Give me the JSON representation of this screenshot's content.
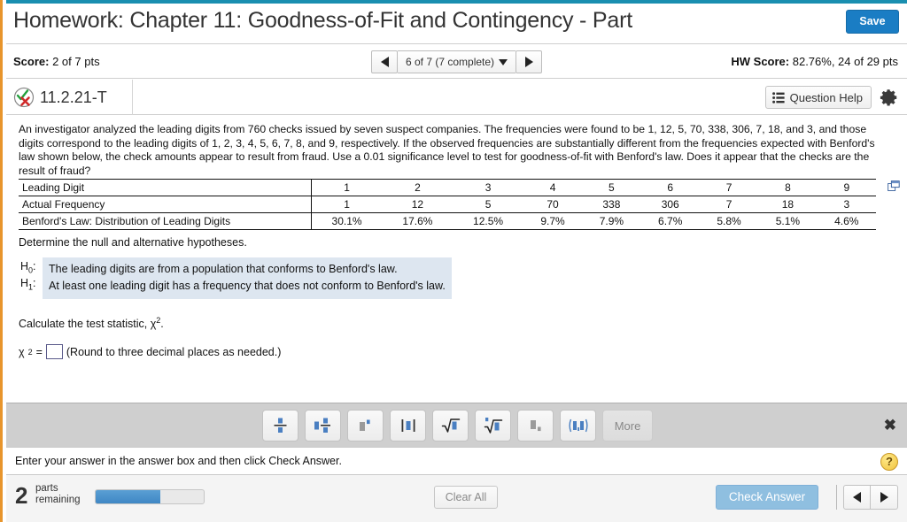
{
  "colors": {
    "top_strip": "#1a8fb0",
    "left_strip": "#e8952c",
    "save_blue": "#1a7dc4",
    "progress_blue": "#3f87c4",
    "hypothesis_bg": "#dde6f0",
    "check_answer_blue": "#8fbfe0",
    "toolbar_gray": "#cfcfcf"
  },
  "header": {
    "title": "Homework: Chapter 11: Goodness-of-Fit and Contingency - Part",
    "save_label": "Save"
  },
  "scorebar": {
    "score_label": "Score:",
    "score_value": "2 of 7 pts",
    "nav_prev_icon": "triangle-left-icon",
    "nav_next_icon": "triangle-right-icon",
    "nav_center_text": "6 of 7 (7 complete)",
    "nav_caret_icon": "chevron-down-icon",
    "hw_score_label": "HW Score:",
    "hw_score_value": "82.76%, 24 of 29 pts"
  },
  "question_bar": {
    "status_icon": "check-x-circle-icon",
    "question_id": "11.2.21-T",
    "question_help_label": "Question Help",
    "question_help_icon": "list-icon",
    "settings_icon": "gear-icon"
  },
  "question": {
    "prompt": "An investigator analyzed the leading digits from 760 checks issued by seven suspect companies. The frequencies were found to be 1, 12, 5, 70, 338, 306, 7, 18, and 3, and those digits correspond to the leading digits of 1, 2, 3, 4, 5, 6, 7, 8, and 9, respectively. If the observed frequencies are substantially different from the frequencies expected with Benford's law shown below, the check amounts appear to result from fraud. Use a 0.01 significance level to test for goodness-of-fit with Benford's law. Does it appear that the checks are the result of fraud?",
    "copy_icon": "copy-to-spreadsheet-icon",
    "determine_text": "Determine the null and alternative hypotheses.",
    "h0_label": "H",
    "h0_sub": "0",
    "h0_text": "The leading digits are from a population that conforms to Benford's law.",
    "h1_label": "H",
    "h1_sub": "1",
    "h1_text": "At least one leading digit has a frequency that does not conform to Benford's law.",
    "calc_text_pre": "Calculate the test statistic, ",
    "calc_chi": "χ",
    "calc_sup": "2",
    "calc_text_post": ".",
    "answer_chi": "χ",
    "answer_sup": "2",
    "answer_eq": "=",
    "answer_value": "",
    "answer_hint": "(Round to three decimal places as needed.)"
  },
  "chart_data": {
    "type": "table",
    "title": "Benford's Law Leading Digit Frequency Table",
    "row_headers": [
      "Leading Digit",
      "Actual Frequency",
      "Benford's Law: Distribution of Leading Digits"
    ],
    "categories": [
      "1",
      "2",
      "3",
      "4",
      "5",
      "6",
      "7",
      "8",
      "9"
    ],
    "rows": [
      {
        "label": "Leading Digit",
        "values": [
          "1",
          "2",
          "3",
          "4",
          "5",
          "6",
          "7",
          "8",
          "9"
        ]
      },
      {
        "label": "Actual Frequency",
        "values": [
          "1",
          "12",
          "5",
          "70",
          "338",
          "306",
          "7",
          "18",
          "3"
        ]
      },
      {
        "label": "Benford's Law: Distribution of Leading Digits",
        "values": [
          "30.1%",
          "17.6%",
          "12.5%",
          "9.7%",
          "7.9%",
          "6.7%",
          "5.8%",
          "5.1%",
          "4.6%"
        ]
      }
    ],
    "series": [
      {
        "name": "Actual Frequency",
        "values": [
          1,
          12,
          5,
          70,
          338,
          306,
          7,
          18,
          3
        ]
      },
      {
        "name": "Benford's Law (%)",
        "values": [
          30.1,
          17.6,
          12.5,
          9.7,
          7.9,
          6.7,
          5.8,
          5.1,
          4.6
        ]
      }
    ],
    "xlabel": "Leading Digit",
    "ylabel": ""
  },
  "math_toolbar": {
    "buttons": [
      {
        "name": "fraction-button",
        "glyph": "fraction"
      },
      {
        "name": "mixed-fraction-button",
        "glyph": "mixed-fraction"
      },
      {
        "name": "exponent-button",
        "glyph": "exponent"
      },
      {
        "name": "absolute-value-button",
        "glyph": "absolute"
      },
      {
        "name": "square-root-button",
        "glyph": "sqrt"
      },
      {
        "name": "nth-root-button",
        "glyph": "nthroot"
      },
      {
        "name": "subscript-button",
        "glyph": "subscript"
      },
      {
        "name": "interval-button",
        "glyph": "interval"
      }
    ],
    "more_label": "More",
    "close_icon": "close-icon",
    "close_glyph": "✖"
  },
  "instruction": {
    "text": "Enter your answer in the answer box and then click Check Answer.",
    "help_icon": "question-mark-icon",
    "help_glyph": "?"
  },
  "footer": {
    "parts_count": "2",
    "parts_word_1": "parts",
    "parts_word_2": "remaining",
    "progress_percent": 60,
    "clear_all_label": "Clear All",
    "check_answer_label": "Check Answer",
    "nav_prev_icon": "triangle-left-icon",
    "nav_next_icon": "triangle-right-icon"
  }
}
